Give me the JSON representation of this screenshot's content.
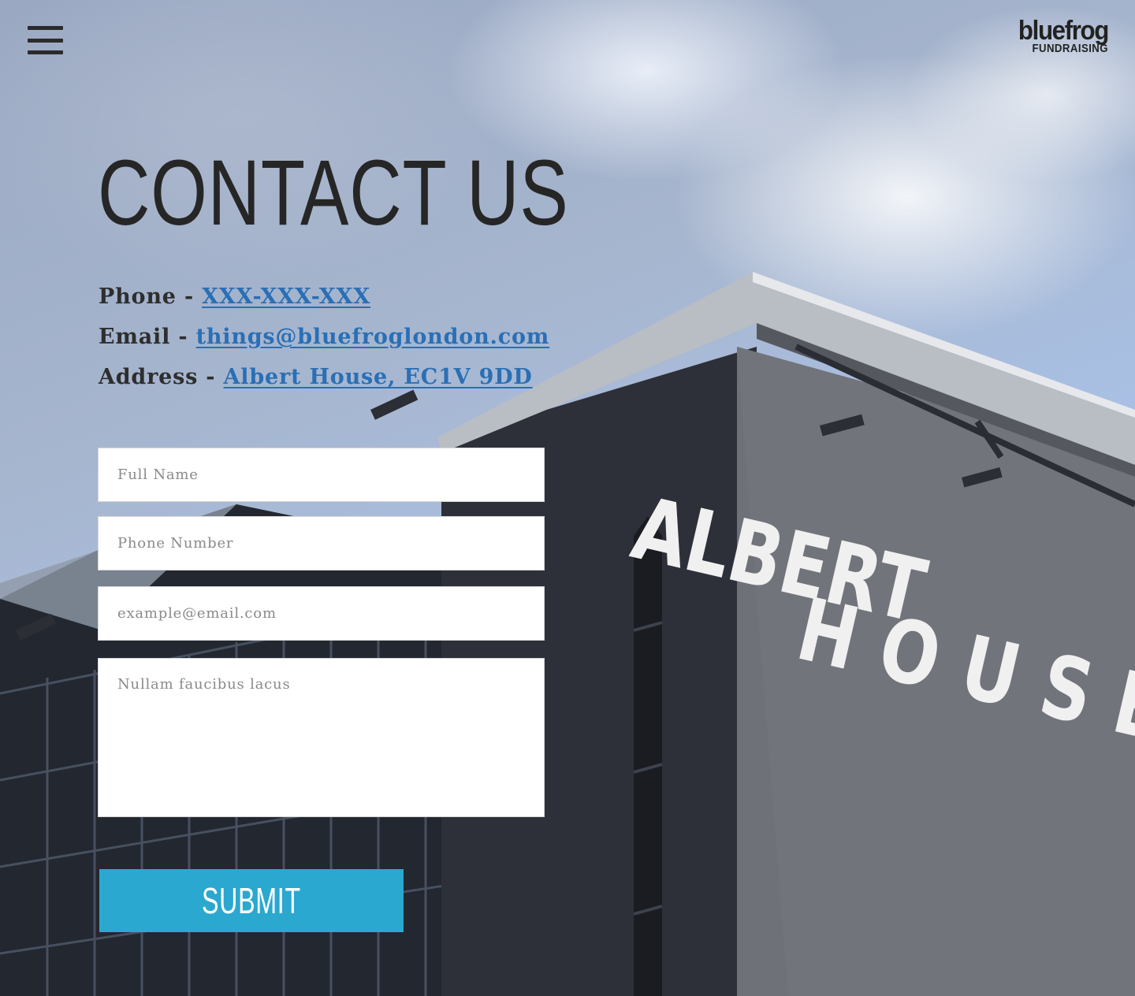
{
  "header": {
    "menu_icon": "hamburger-menu-icon",
    "logo_line1": "bluefrog",
    "logo_line2": "FUNDRAISING"
  },
  "main": {
    "title": "Contact Us",
    "contact": {
      "phone_label": "Phone - ",
      "phone_value": "XXX-XXX-XXX",
      "email_label": "Email - ",
      "email_value": "things@bluefroglondon.com",
      "address_label": "Address - ",
      "address_value": "Albert House, EC1V 9DD"
    }
  },
  "form": {
    "name_placeholder": "Full Name",
    "phone_placeholder": "Phone Number",
    "email_placeholder": "example@email.com",
    "message_placeholder": "Nullam faucibus lacus",
    "submit_label": "SUBMIT"
  },
  "background": {
    "sign_line1": "ALBERT",
    "sign_line2": "HOUSE"
  },
  "colors": {
    "link": "#2a6fb5",
    "submit_bg": "#2aa8cf",
    "text_dark": "#262626"
  }
}
